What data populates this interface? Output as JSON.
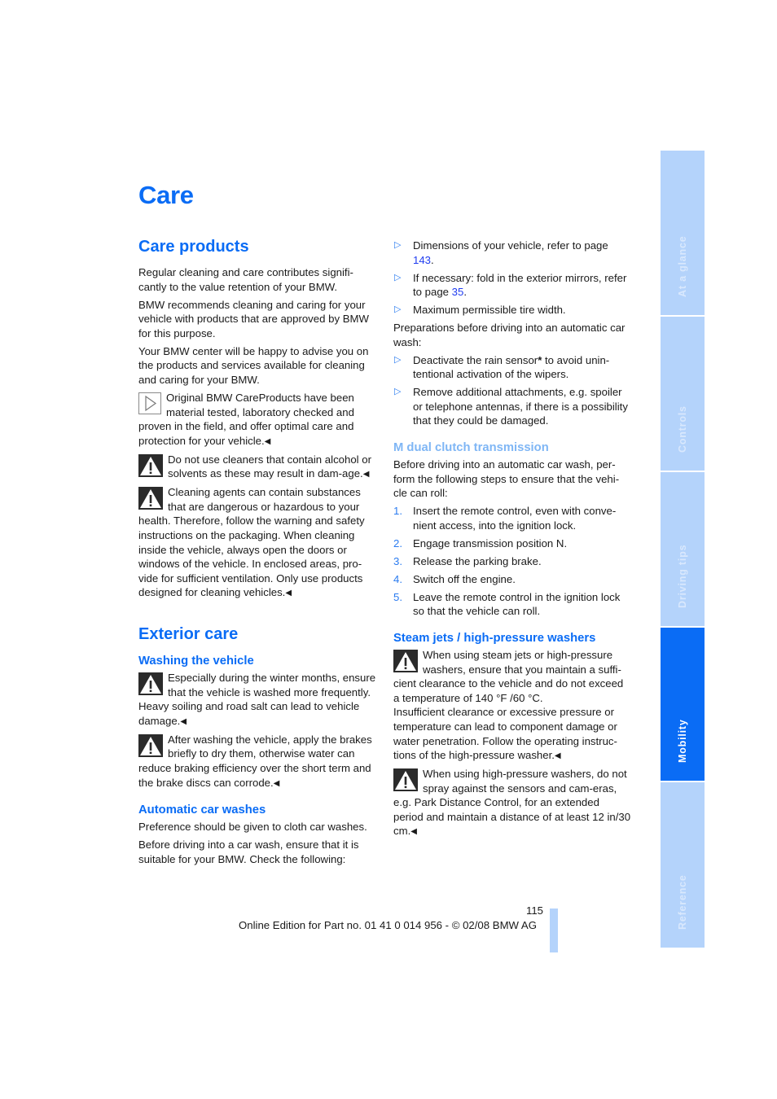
{
  "page": {
    "title": "Care",
    "page_number": "115",
    "footer": "Online Edition for Part no. 01 41 0 014 956 - © 02/08 BMW AG"
  },
  "side_tabs": [
    {
      "label": "At a glance",
      "active": false
    },
    {
      "label": "Controls",
      "active": false
    },
    {
      "label": "Driving tips",
      "active": false
    },
    {
      "label": "Mobility",
      "active": true
    },
    {
      "label": "Reference",
      "active": false
    }
  ],
  "care_products": {
    "heading": "Care products",
    "p1": "Regular cleaning and care contributes signifi-cantly to the value retention of your BMW.",
    "p2": "BMW recommends cleaning and caring for your vehicle with products that are approved by BMW for this purpose.",
    "p3": "Your BMW center will be happy to advise you on the products and services available for cleaning and caring for your BMW.",
    "note_info": "Original BMW CareProducts have been material tested, laboratory checked and proven in the field, and offer optimal care and protection for your vehicle.",
    "warn1": "Do not use cleaners that contain alcohol or solvents as these may result in dam-age.",
    "warn2": "Cleaning agents can contain substances that are dangerous or hazardous to your health. Therefore, follow the warning and safety instructions on the packaging. When cleaning inside the vehicle, always open the doors or windows of the vehicle. In enclosed areas, pro-vide for sufficient ventilation. Only use products designed for cleaning vehicles."
  },
  "exterior_care": {
    "heading": "Exterior care",
    "washing": {
      "heading": "Washing the vehicle",
      "warn1": "Especially during the winter months, ensure that the vehicle is washed more frequently. Heavy soiling and road salt can lead to vehicle damage.",
      "warn2": "After washing the vehicle, apply the brakes briefly to dry them, otherwise water can reduce braking efficiency over the short term and the brake discs can corrode."
    },
    "automatic": {
      "heading": "Automatic car washes",
      "p1": "Preference should be given to cloth car washes.",
      "p2": "Before driving into a car wash, ensure that it is suitable for your BMW. Check the following:",
      "checks": [
        {
          "text": "Dimensions of your vehicle, refer to page ",
          "link": "143",
          "after": "."
        },
        {
          "text": "If necessary: fold in the exterior mirrors, refer to page ",
          "link": "35",
          "after": "."
        },
        {
          "text": "Maximum permissible tire width.",
          "link": "",
          "after": ""
        }
      ],
      "prep_intro": "Preparations before driving into an automatic car wash:",
      "prep": [
        {
          "before": "Deactivate the rain sensor",
          "star": "*",
          "after": " to avoid unin-tentional activation of the wipers."
        },
        {
          "before": "Remove additional attachments, e.g. spoiler or telephone antennas, if there is a possibility that they could be damaged.",
          "star": "",
          "after": ""
        }
      ]
    },
    "mdct": {
      "heading": "M dual clutch transmission",
      "intro": "Before driving into an automatic car wash, per-form the following steps to ensure that the vehi-cle can roll:",
      "steps": [
        "Insert the remote control, even with conve-nient access, into the ignition lock.",
        "Engage transmission position N.",
        "Release the parking brake.",
        "Switch off the engine.",
        "Leave the remote control in the ignition lock so that the vehicle can roll."
      ]
    },
    "steam": {
      "heading": "Steam jets / high-pressure washers",
      "warn1": "When using steam jets or high-pressure washers, ensure that you maintain a suffi-cient clearance to the vehicle and do not exceed a temperature of 140 °F /60 °C.",
      "warn1b": "Insufficient clearance or excessive pressure or temperature can lead to component damage or water penetration. Follow the operating instruc-tions of the high-pressure washer.",
      "warn2": "When using high-pressure washers, do not spray against the sensors and cam-eras, e.g. Park Distance Control, for an extended period and maintain a distance of at least 12 in/30 cm."
    }
  },
  "glyphs": {
    "end_mark": "◀",
    "bullet": "▷"
  },
  "colors": {
    "heading_blue": "#0a6cf5",
    "subheading_light": "#7fb6f5",
    "tab_inactive": "#b4d3fb",
    "tab_active": "#0a6cf5",
    "link": "#1f3cf0"
  }
}
